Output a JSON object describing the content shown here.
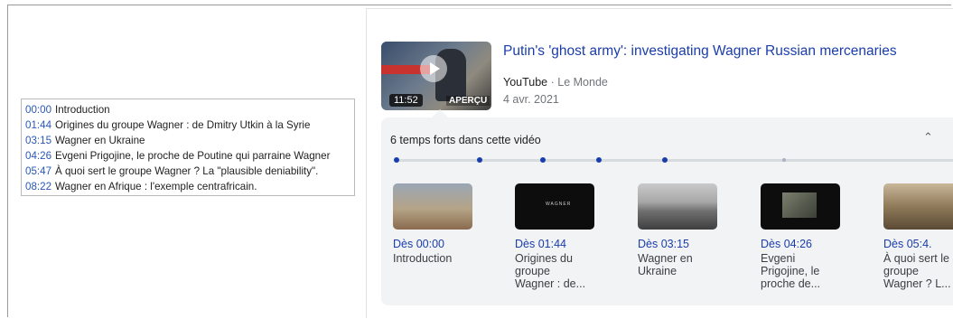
{
  "chapter_list": [
    {
      "time": "00:00",
      "label": "Introduction"
    },
    {
      "time": "01:44",
      "label": "Origines du groupe Wagner : de Dmitry Utkin à la Syrie"
    },
    {
      "time": "03:15",
      "label": "Wagner en Ukraine"
    },
    {
      "time": "04:26",
      "label": "Evgeni Prigojine, le proche de Poutine qui parraine Wagner"
    },
    {
      "time": "05:47",
      "label": "À quoi sert le groupe Wagner ? La \"plausible deniability\"."
    },
    {
      "time": "08:22",
      "label": "Wagner en Afrique : l'exemple centrafricain."
    }
  ],
  "video": {
    "title": "Putin's 'ghost army': investigating Wagner Russian mercenaries",
    "source": "YouTube",
    "separator": "·",
    "channel": "Le Monde",
    "date": "4 avr. 2021",
    "duration": "11:52",
    "preview_label": "APERÇU",
    "thumbnail_icon": "play-icon"
  },
  "key_moments": {
    "heading": "6 temps forts dans cette vidéo",
    "collapse_icon": "chevron-up-icon",
    "next_icon": "chevron-right-icon",
    "items": [
      {
        "ts": "Dès 00:00",
        "label": "Introduction"
      },
      {
        "ts": "Dès 01:44",
        "label": "Origines du groupe Wagner : de..."
      },
      {
        "ts": "Dès 03:15",
        "label": "Wagner en Ukraine"
      },
      {
        "ts": "Dès 04:26",
        "label": "Evgeni Prigojine, le proche de..."
      },
      {
        "ts": "Dès 05:4.",
        "label": "À quoi sert le groupe Wagner ? L..."
      }
    ],
    "thumb_text_b": "WAGNER"
  },
  "colors": {
    "link": "#1a3dab",
    "timestamp": "#2a58b8",
    "panel_bg": "#f1f3f4"
  }
}
